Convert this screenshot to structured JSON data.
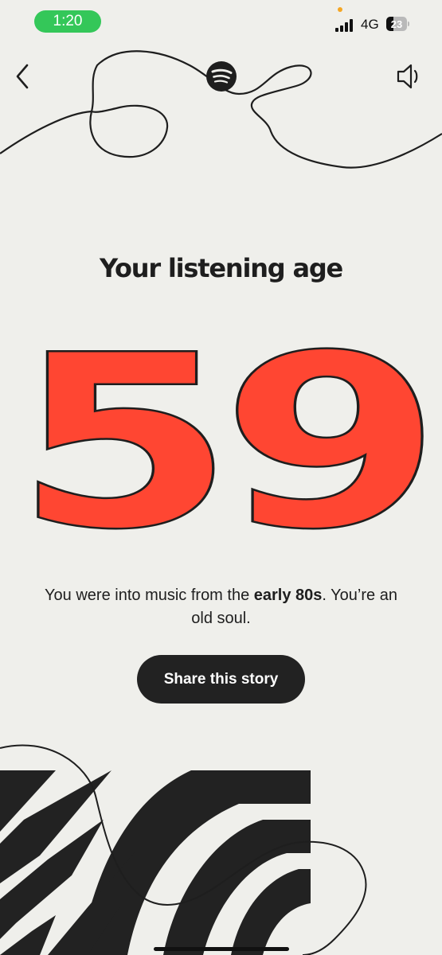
{
  "status_bar": {
    "time": "1:20",
    "network": "4G",
    "battery": "23"
  },
  "header": {
    "back_icon": "chevron-left-icon",
    "logo_icon": "spotify-logo-icon",
    "sound_icon": "speaker-icon"
  },
  "story": {
    "title": "Your listening age",
    "age": "59",
    "caption_before": "You were into music from the ",
    "caption_bold": "early 80s",
    "caption_after": ". You’re an old soul.",
    "share_label": "Share this story"
  },
  "colors": {
    "background": "#efefeb",
    "accent": "#ff4632",
    "ink": "#1e1e1e",
    "status_green": "#34c759"
  }
}
